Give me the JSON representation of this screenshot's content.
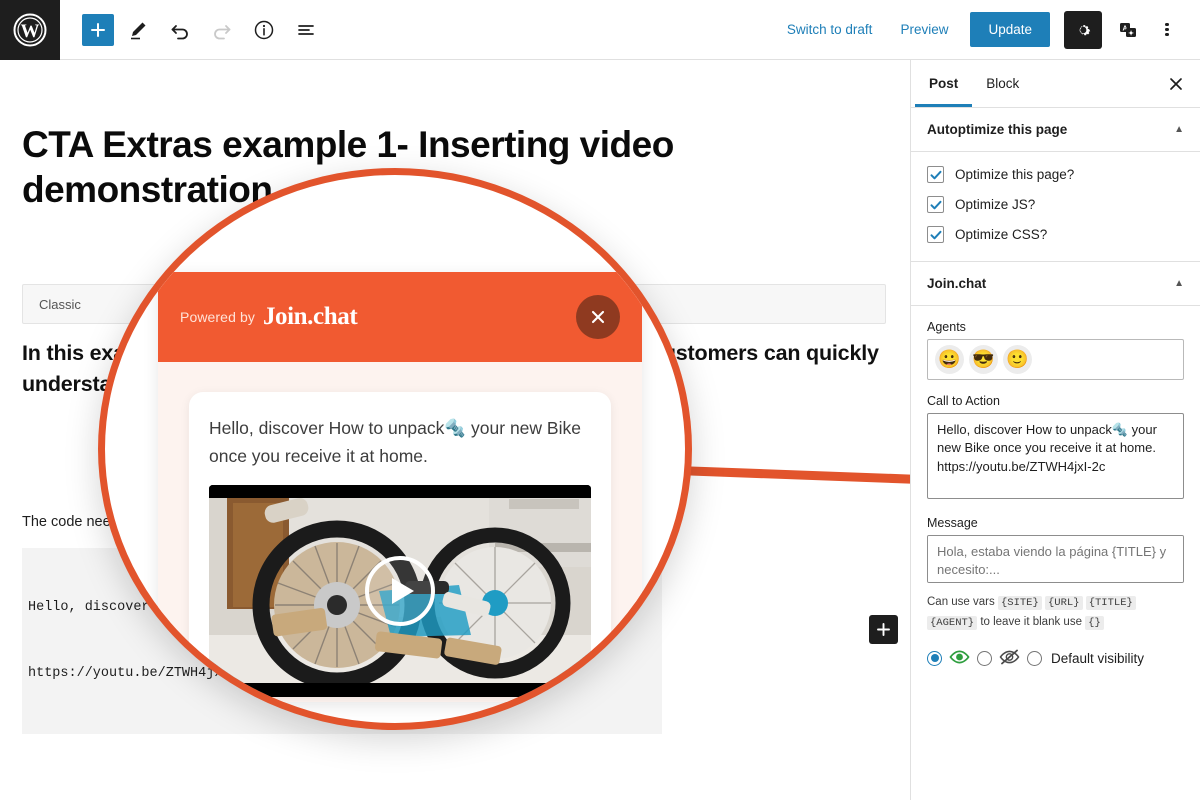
{
  "toolbar": {
    "logo_icon": "wordpress-logo-icon",
    "add_block_label": "+",
    "tools": [
      {
        "name": "add-block",
        "icon": "plus-icon"
      },
      {
        "name": "edit-mode",
        "icon": "pencil-icon"
      },
      {
        "name": "undo",
        "icon": "undo-arrow-icon"
      },
      {
        "name": "redo",
        "icon": "redo-arrow-icon"
      },
      {
        "name": "details",
        "icon": "info-circle-icon"
      },
      {
        "name": "list-view",
        "icon": "list-view-icon"
      }
    ],
    "switch_to_draft": "Switch to draft",
    "preview": "Preview",
    "update": "Update",
    "settings_icon": "gear-icon",
    "translate_icon": "translate-icon",
    "more_icon": "kebab-menu-icon"
  },
  "editor": {
    "post_title": "CTA Extras example 1- Inserting video demonstration",
    "block_label": "Classic",
    "body_bold": "In this example we will add a video to the chat window, so that customers can quickly understand how they should unpack their new bike.",
    "body_plain": "The code needed to insert the video is:",
    "code_line_1": "Hello, discover How to unpack your new Bike.",
    "code_line_2": "https://youtu.be/ZTWH4jxI-2c",
    "inserter_label": "+"
  },
  "magnifier": {
    "chat": {
      "powered_by": "Powered by",
      "brand": "Join.chat",
      "close_icon": "close-x-icon",
      "bubble_text": "Hello, discover How to unpack🔩 your new Bike once you receive it at home.",
      "video_alt": "packed-bicycle-video-thumbnail",
      "play_icon": "play-button-icon"
    },
    "accent_color": "#e2542c",
    "header_color": "#f15a31"
  },
  "sidebar": {
    "tabs": [
      {
        "label": "Post",
        "active": true
      },
      {
        "label": "Block",
        "active": false
      }
    ],
    "close_icon": "close-x-icon",
    "panels": [
      {
        "title": "Autoptimize this page",
        "caret": "▲",
        "checkboxes": [
          {
            "label": "Optimize this page?",
            "checked": true
          },
          {
            "label": "Optimize JS?",
            "checked": true
          },
          {
            "label": "Optimize CSS?",
            "checked": true
          }
        ]
      },
      {
        "title": "Join.chat",
        "caret": "▲"
      }
    ],
    "joinchat": {
      "agents_label": "Agents",
      "agents": [
        "😀",
        "😎",
        "🙂"
      ],
      "cta_label": "Call to Action",
      "cta_value": "Hello, discover How to unpack🔩 your new Bike once you receive it at home. https://youtu.be/ZTWH4jxI-2c",
      "message_label": "Message",
      "message_placeholder": "Hola, estaba viendo la página {TITLE} y necesito:...",
      "vars_hint_before": "Can use vars",
      "vars": [
        "{SITE}",
        "{URL}",
        "{TITLE}",
        "{AGENT}"
      ],
      "vars_hint_after": "to leave it blank use",
      "empty_var": "{}",
      "visibility": {
        "show_icon": "eye-visible-icon",
        "hide_icon": "eye-hidden-icon",
        "default_label": "Default visibility",
        "selected": "show"
      }
    }
  },
  "colors": {
    "wp_blue": "#1e7fb8",
    "dark": "#1e1e1e",
    "orange": "#f15a31",
    "orange_ring": "#e2542c",
    "green": "#4caf50"
  }
}
